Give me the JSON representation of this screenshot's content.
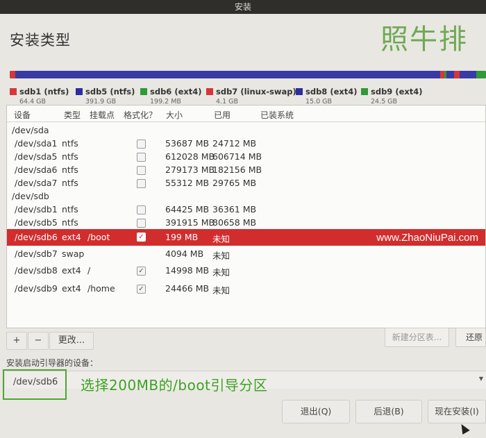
{
  "window": {
    "title": "安装"
  },
  "page": {
    "title": "安装类型",
    "watermark": "照牛排"
  },
  "colors": {
    "accent_selected": "#d22d2d",
    "annotation_green": "#3aa321"
  },
  "partitions_legend": [
    {
      "name": "sdb1 (ntfs)",
      "size": "64.4 GB",
      "color": "#d4383a"
    },
    {
      "name": "sdb5 (ntfs)",
      "size": "391.9 GB",
      "color": "#2c2ca3"
    },
    {
      "name": "sdb6 (ext4)",
      "size": "199.2 MB",
      "color": "#2f9a36"
    },
    {
      "name": "sdb7 (linux-swap)",
      "size": "4.1 GB",
      "color": "#d4383a"
    },
    {
      "name": "sdb8 (ext4)",
      "size": "15.0 GB",
      "color": "#2c2ca3"
    },
    {
      "name": "sdb9 (ext4)",
      "size": "24.5 GB",
      "color": "#2f9a36"
    }
  ],
  "table": {
    "headers": [
      "设备",
      "类型",
      "挂载点",
      "格式化？",
      "大小",
      "已用",
      "已装系统"
    ],
    "rows": [
      {
        "device": "/dev/sda",
        "type": "",
        "mount": "",
        "format": "none",
        "size": "",
        "used": ""
      },
      {
        "device": "/dev/sda1",
        "type": "ntfs",
        "mount": "",
        "format": "unchecked",
        "size": "53687 MB",
        "used": "24712 MB"
      },
      {
        "device": "/dev/sda5",
        "type": "ntfs",
        "mount": "",
        "format": "unchecked",
        "size": "612028 MB",
        "used": "606714 MB"
      },
      {
        "device": "/dev/sda6",
        "type": "ntfs",
        "mount": "",
        "format": "unchecked",
        "size": "279173 MB",
        "used": "182156 MB"
      },
      {
        "device": "/dev/sda7",
        "type": "ntfs",
        "mount": "",
        "format": "unchecked",
        "size": "55312 MB",
        "used": "29765 MB"
      },
      {
        "device": "/dev/sdb",
        "type": "",
        "mount": "",
        "format": "none",
        "size": "",
        "used": ""
      },
      {
        "device": "/dev/sdb1",
        "type": "ntfs",
        "mount": "",
        "format": "unchecked",
        "size": "64425 MB",
        "used": "36361 MB"
      },
      {
        "device": "/dev/sdb5",
        "type": "ntfs",
        "mount": "",
        "format": "unchecked",
        "size": "391915 MB",
        "used": "80658 MB"
      },
      {
        "device": "/dev/sdb6",
        "type": "ext4",
        "mount": "/boot",
        "format": "checked",
        "size": "199 MB",
        "used": "未知",
        "selected": true
      },
      {
        "device": "/dev/sdb7",
        "type": "swap",
        "mount": "",
        "format": "none",
        "size": "4094 MB",
        "used": "未知"
      },
      {
        "device": "/dev/sdb8",
        "type": "ext4",
        "mount": "/",
        "format": "checked",
        "size": "14998 MB",
        "used": "未知"
      },
      {
        "device": "/dev/sdb9",
        "type": "ext4",
        "mount": "/home",
        "format": "checked",
        "size": "24466 MB",
        "used": "未知"
      }
    ],
    "selected_watermark": "www.ZhaoNiuPai.com"
  },
  "toolbar": {
    "add_label": "+",
    "remove_label": "−",
    "change_label": "更改...",
    "new_table_label": "新建分区表...",
    "revert_label": "还原"
  },
  "bootloader": {
    "label": "安装启动引导器的设备：",
    "value": "/dev/sdb6",
    "annotation": "选择200MB的/boot引导分区"
  },
  "buttons": {
    "quit": "退出(Q)",
    "back": "后退(B)",
    "install_now": "现在安装(I)"
  }
}
